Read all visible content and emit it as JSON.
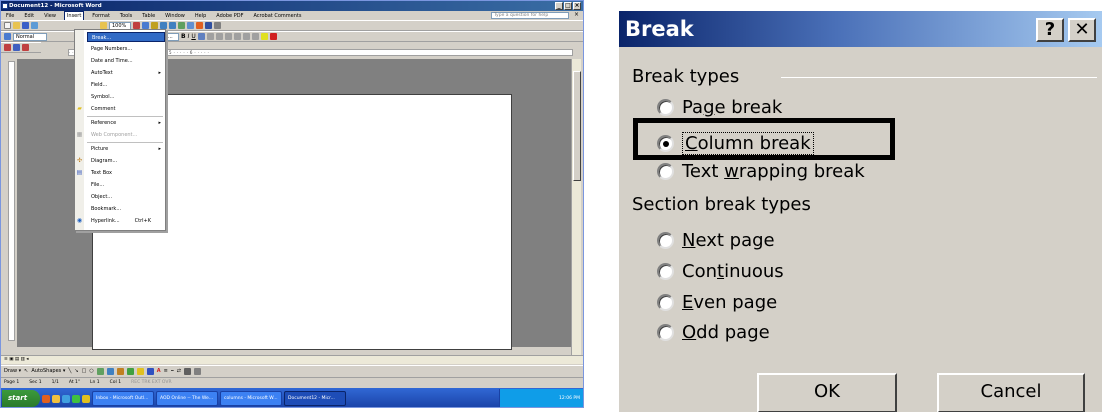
{
  "word": {
    "title": "Document12 - Microsoft Word",
    "menu": [
      "File",
      "Edit",
      "View",
      "Insert",
      "Format",
      "Tools",
      "Table",
      "Window",
      "Help",
      "Adobe PDF",
      "Acrobat Comments"
    ],
    "help_placeholder": "Type a question for help",
    "style_value": "Normal",
    "zoom_value": "100%",
    "thesaurus_label": "Thesaurus...",
    "insert_menu": [
      {
        "label": "Break...",
        "highlighted": true
      },
      {
        "label": "Page Numbers..."
      },
      {
        "label": "Date and Time..."
      },
      {
        "label": "AutoText",
        "submenu": true
      },
      {
        "label": "Field..."
      },
      {
        "label": "Symbol..."
      },
      {
        "label": "Comment"
      },
      {
        "label": "Reference",
        "submenu": true
      },
      {
        "label": "Web Component...",
        "disabled": true
      },
      {
        "label": "Picture",
        "submenu": true
      },
      {
        "label": "Diagram..."
      },
      {
        "label": "Text Box"
      },
      {
        "label": "File..."
      },
      {
        "label": "Object..."
      },
      {
        "label": "Bookmark..."
      },
      {
        "label": "Hyperlink...",
        "shortcut": "Ctrl+K"
      }
    ],
    "draw_label": "Draw ▾",
    "autoshapes_label": "AutoShapes ▾",
    "status": {
      "page": "Page 1",
      "sec": "Sec 1",
      "pages": "1/1",
      "at": "At 1\"",
      "ln": "Ln 1",
      "col": "Col 1",
      "modes": "REC  TRK  EXT  OVR"
    },
    "taskbar": {
      "start": "start",
      "tasks": [
        "Inbox - Microsoft Outl...",
        "AOD Online -- The We...",
        "columns - Microsoft W...",
        "Document12 - Micr..."
      ],
      "clock": "12:06 PM"
    }
  },
  "dialog": {
    "title": "Break",
    "help_button": "?",
    "close_button": "✕",
    "break_types_label": "Break types",
    "section_types_label": "Section break types",
    "options": {
      "page_break": {
        "pre": "Pa",
        "u": "g",
        "post": "e break"
      },
      "column_break": {
        "pre": "",
        "u": "C",
        "post": "olumn break"
      },
      "text_wrapping": {
        "pre": "Text ",
        "u": "w",
        "post": "rapping break"
      },
      "next_page": {
        "pre": "",
        "u": "N",
        "post": "ext page"
      },
      "continuous": {
        "pre": "Con",
        "u": "t",
        "post": "inuous"
      },
      "even_page": {
        "pre": "",
        "u": "E",
        "post": "ven page"
      },
      "odd_page": {
        "pre": "",
        "u": "O",
        "post": "dd page"
      }
    },
    "selected": "column_break",
    "ok_label": "OK",
    "cancel_label": "Cancel"
  }
}
